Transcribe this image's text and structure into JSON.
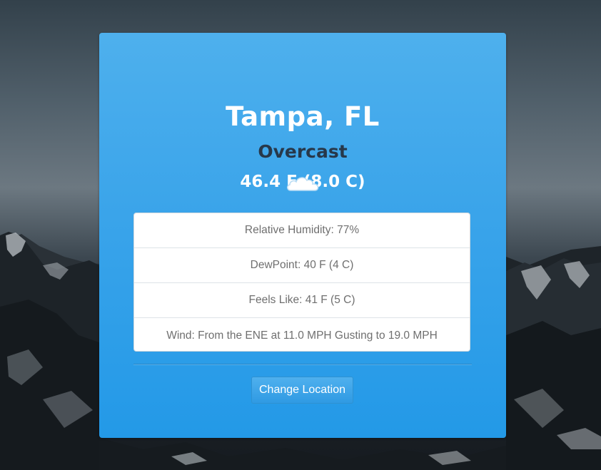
{
  "location": {
    "city": "Tampa, FL"
  },
  "current": {
    "condition": "Overcast",
    "temperature": "46.4 F (8.0 C)",
    "icon": "cloud-icon"
  },
  "details": [
    {
      "label": "Relative Humidity: 77%"
    },
    {
      "label": "DewPoint: 40 F (4 C)"
    },
    {
      "label": "Feels Like: 41 F (5 C)"
    },
    {
      "label": "Wind: From the ENE at 11.0 MPH Gusting to 19.0 MPH"
    }
  ],
  "actions": {
    "change_location_label": "Change Location"
  },
  "colors": {
    "card_top": "#4eb0ed",
    "card_bottom": "#2399e7",
    "condition_text": "#27384a",
    "list_text": "#6f6f6f"
  }
}
